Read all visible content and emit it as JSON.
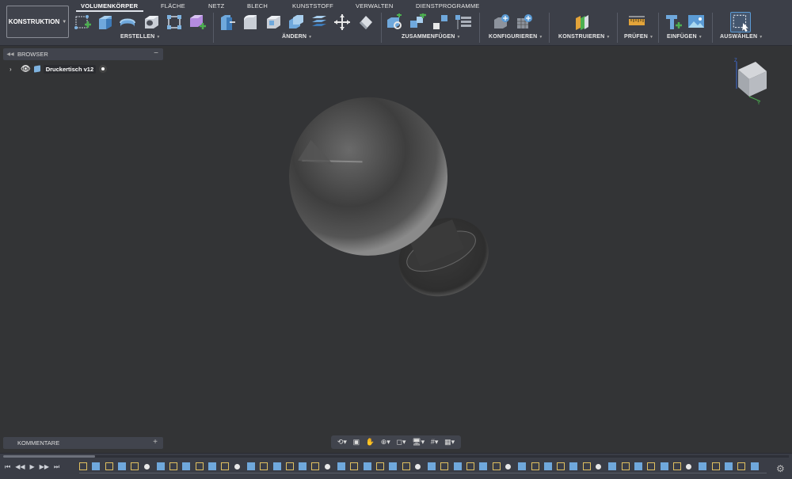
{
  "workspace": {
    "label": "KONSTRUKTION"
  },
  "tabs": [
    {
      "label": "VOLUMENKÖRPER",
      "active": true
    },
    {
      "label": "FLÄCHE"
    },
    {
      "label": "NETZ"
    },
    {
      "label": "BLECH"
    },
    {
      "label": "KUNSTSTOFF"
    },
    {
      "label": "VERWALTEN"
    },
    {
      "label": "DIENSTPROGRAMME"
    }
  ],
  "groups": {
    "erstellen": "ERSTELLEN",
    "aendern": "ÄNDERN",
    "zusammenfuegen": "ZUSAMMENFÜGEN",
    "konfigurieren": "KONFIGURIEREN",
    "konstruieren": "KONSTRUIEREN",
    "pruefen": "PRÜFEN",
    "einfuegen": "EINFÜGEN",
    "auswaehlen": "AUSWÄHLEN"
  },
  "browser": {
    "title": "BROWSER",
    "document": "Druckertisch v12"
  },
  "comments": {
    "title": "KOMMENTARE"
  },
  "colors": {
    "accent": "#5b9bd5",
    "toolbar": "#3c3f48",
    "canvas": "#333436"
  }
}
